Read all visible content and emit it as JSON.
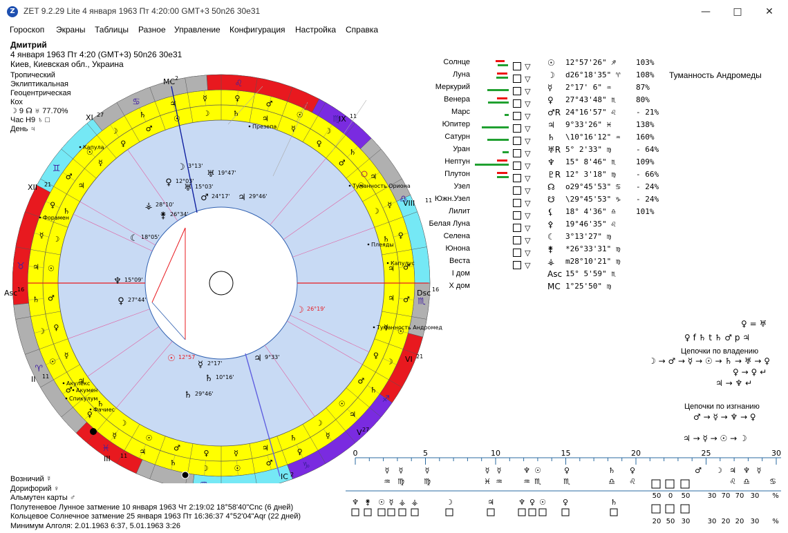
{
  "window": {
    "title": "ZET 9.2.29 Lite    4 января 1963  Пт   4:20:00 GMT+3 50n26  30e31",
    "logo": "Z"
  },
  "menu": [
    "Гороскоп",
    "Экраны",
    "Таблицы",
    "Разное",
    "Управление",
    "Конфигурация",
    "Настройка",
    "Справка"
  ],
  "person": {
    "name": "Дмитрий",
    "line2": "4 января 1963  Пт   4:20 (GMT+3) 50n26  30e31",
    "line3": "Киев, Киевская обл., Украина"
  },
  "system": [
    "Тропический",
    "Эклиптикальная",
    "Геоцентрическая",
    "Кох",
    "☽  9  ☊ ♅ 77.70%",
    "Час H9  ♄  □",
    "День  ♃"
  ],
  "planets": [
    {
      "name": "Солнце",
      "glyph": "☉",
      "pos": "12°57'26\" ♐",
      "pct": "103%",
      "extra": ""
    },
    {
      "name": "Луна",
      "glyph": "☽",
      "pos": "d26°18'35\" ♈",
      "pct": "108%",
      "extra": "Туманность Андромеды"
    },
    {
      "name": "Меркурий",
      "glyph": "☿",
      "pos": "2°17' 6\" ♒",
      "pct": "87%",
      "extra": ""
    },
    {
      "name": "Венера",
      "glyph": "♀",
      "pos": "27°43'48\" ♏",
      "pct": "80%",
      "extra": ""
    },
    {
      "name": "Марс",
      "glyph": "♂R",
      "pos": "24°16'57\" ♌",
      "pct": "- 21%",
      "extra": ""
    },
    {
      "name": "Юпитер",
      "glyph": "♃",
      "pos": "9°33'26\" ♓",
      "pct": "138%",
      "extra": ""
    },
    {
      "name": "Сатурн",
      "glyph": "♄",
      "pos": "\\10°16'12\" ♒",
      "pct": "160%",
      "extra": ""
    },
    {
      "name": "Уран",
      "glyph": "♅R",
      "pos": "5° 2'33\" ♍",
      "pct": "- 64%",
      "extra": ""
    },
    {
      "name": "Нептун",
      "glyph": "♆",
      "pos": "15° 8'46\" ♏",
      "pct": "109%",
      "extra": ""
    },
    {
      "name": "Плутон",
      "glyph": "♇R",
      "pos": "12° 3'18\" ♍",
      "pct": "- 66%",
      "extra": ""
    },
    {
      "name": "Узел",
      "glyph": "☊",
      "pos": "o29°45'53\" ♋",
      "pct": "- 24%",
      "extra": ""
    },
    {
      "name": "Южн.Узел",
      "glyph": "☋",
      "pos": "\\29°45'53\" ♑",
      "pct": "- 24%",
      "extra": ""
    },
    {
      "name": "Лилит",
      "glyph": "⚸",
      "pos": "18° 4'36\" ♎",
      "pct": "101%",
      "extra": ""
    },
    {
      "name": "Белая Луна",
      "glyph": "⚴",
      "pos": "19°46'35\" ♌",
      "pct": "",
      "extra": ""
    },
    {
      "name": "Селена",
      "glyph": "☾",
      "pos": "3°13'27\" ♍",
      "pct": "",
      "extra": ""
    },
    {
      "name": "Юнона",
      "glyph": "⚵",
      "pos": "*26°33'31\" ♍",
      "pct": "",
      "extra": ""
    },
    {
      "name": "Веста",
      "glyph": "⚶",
      "pos": "m28°10'21\" ♍",
      "pct": "",
      "extra": ""
    },
    {
      "name": "I дом",
      "glyph": "Asc",
      "pos": "15° 5'59\" ♏",
      "pct": "",
      "extra": ""
    },
    {
      "name": "X дом",
      "glyph": "MC",
      "pos": "1°25'50\" ♍",
      "pct": "",
      "extra": ""
    }
  ],
  "chains": {
    "top1": "♀ = ♅",
    "top2": "♀ f ♄ t ♄ ♂ p ♃",
    "own_title": "Цепочки по владению",
    "own1": "☽ → ♂ → ☿ → ☉ → ♄ → ♅ → ♀",
    "own2": "♀ → ♀ ↵",
    "own3": "♃ → ♆ ↵",
    "exile_title": "Цепочки по изгнанию",
    "ex1": "♂ → ☿ → ♆ → ♀",
    "ex2": "♃ → ☿ → ☉ → ☽"
  },
  "lower": {
    "vozn": "Возничий  ☿",
    "dor": "Дорифорий  ♀",
    "alm": "Альмутен карты  ♂",
    "ecl1": "Полутеневое Лунное затмение 10 января 1963 Чт  2:19:02 18°58'40\"Cnc (6 дней)",
    "ecl2": "Кольцевое Солнечное затмение 25 января 1963 Пт 16:36:37  4°52'04\"Aqr (22 дней)",
    "algol": "Минимум Алголя: 2.01.1963  6:37,  5.01.1963  3:26"
  },
  "wheel": {
    "mc": "MC",
    "mc_n": "2",
    "ic": "IC",
    "ic_n": "2",
    "asc": "Asc",
    "asc_n": "16",
    "dsc": "Dsc",
    "dsc_n": "16",
    "houses": [
      "IX",
      "VIII",
      "XII",
      "XI",
      "II",
      "III",
      "VI",
      "V"
    ],
    "house_nums": [
      "11",
      "11",
      "21",
      "27",
      "11",
      "11",
      "21",
      "27"
    ],
    "stars": [
      "Презепа",
      "Капула",
      "Форамен",
      "Туманность Ориона",
      "Плеяды",
      "Капулус",
      "Туманность Андромеды",
      "Акулекс",
      "Акумен",
      "Спикулум",
      "Фачиес"
    ],
    "planet_labels": [
      "3°13'",
      "19°47'",
      "12°03'",
      "15°03'",
      "24°17'",
      "29°46'",
      "28°10'",
      "26°34'",
      "18°05'",
      "15°09'",
      "27°44'",
      "26°19'",
      "12°57",
      "2°17'",
      "9°33'",
      "10°16'",
      "29°46'"
    ]
  },
  "ruler": {
    "ticks": [
      "0",
      "5",
      "10",
      "15",
      "20",
      "25",
      "30"
    ]
  },
  "accent": {
    "red": "#e8191f",
    "purple": "#7a2be0",
    "cyan": "#75e8f5",
    "yellow": "#ffff00",
    "gray": "#b0b0b0",
    "inner": "#c8daf4"
  }
}
